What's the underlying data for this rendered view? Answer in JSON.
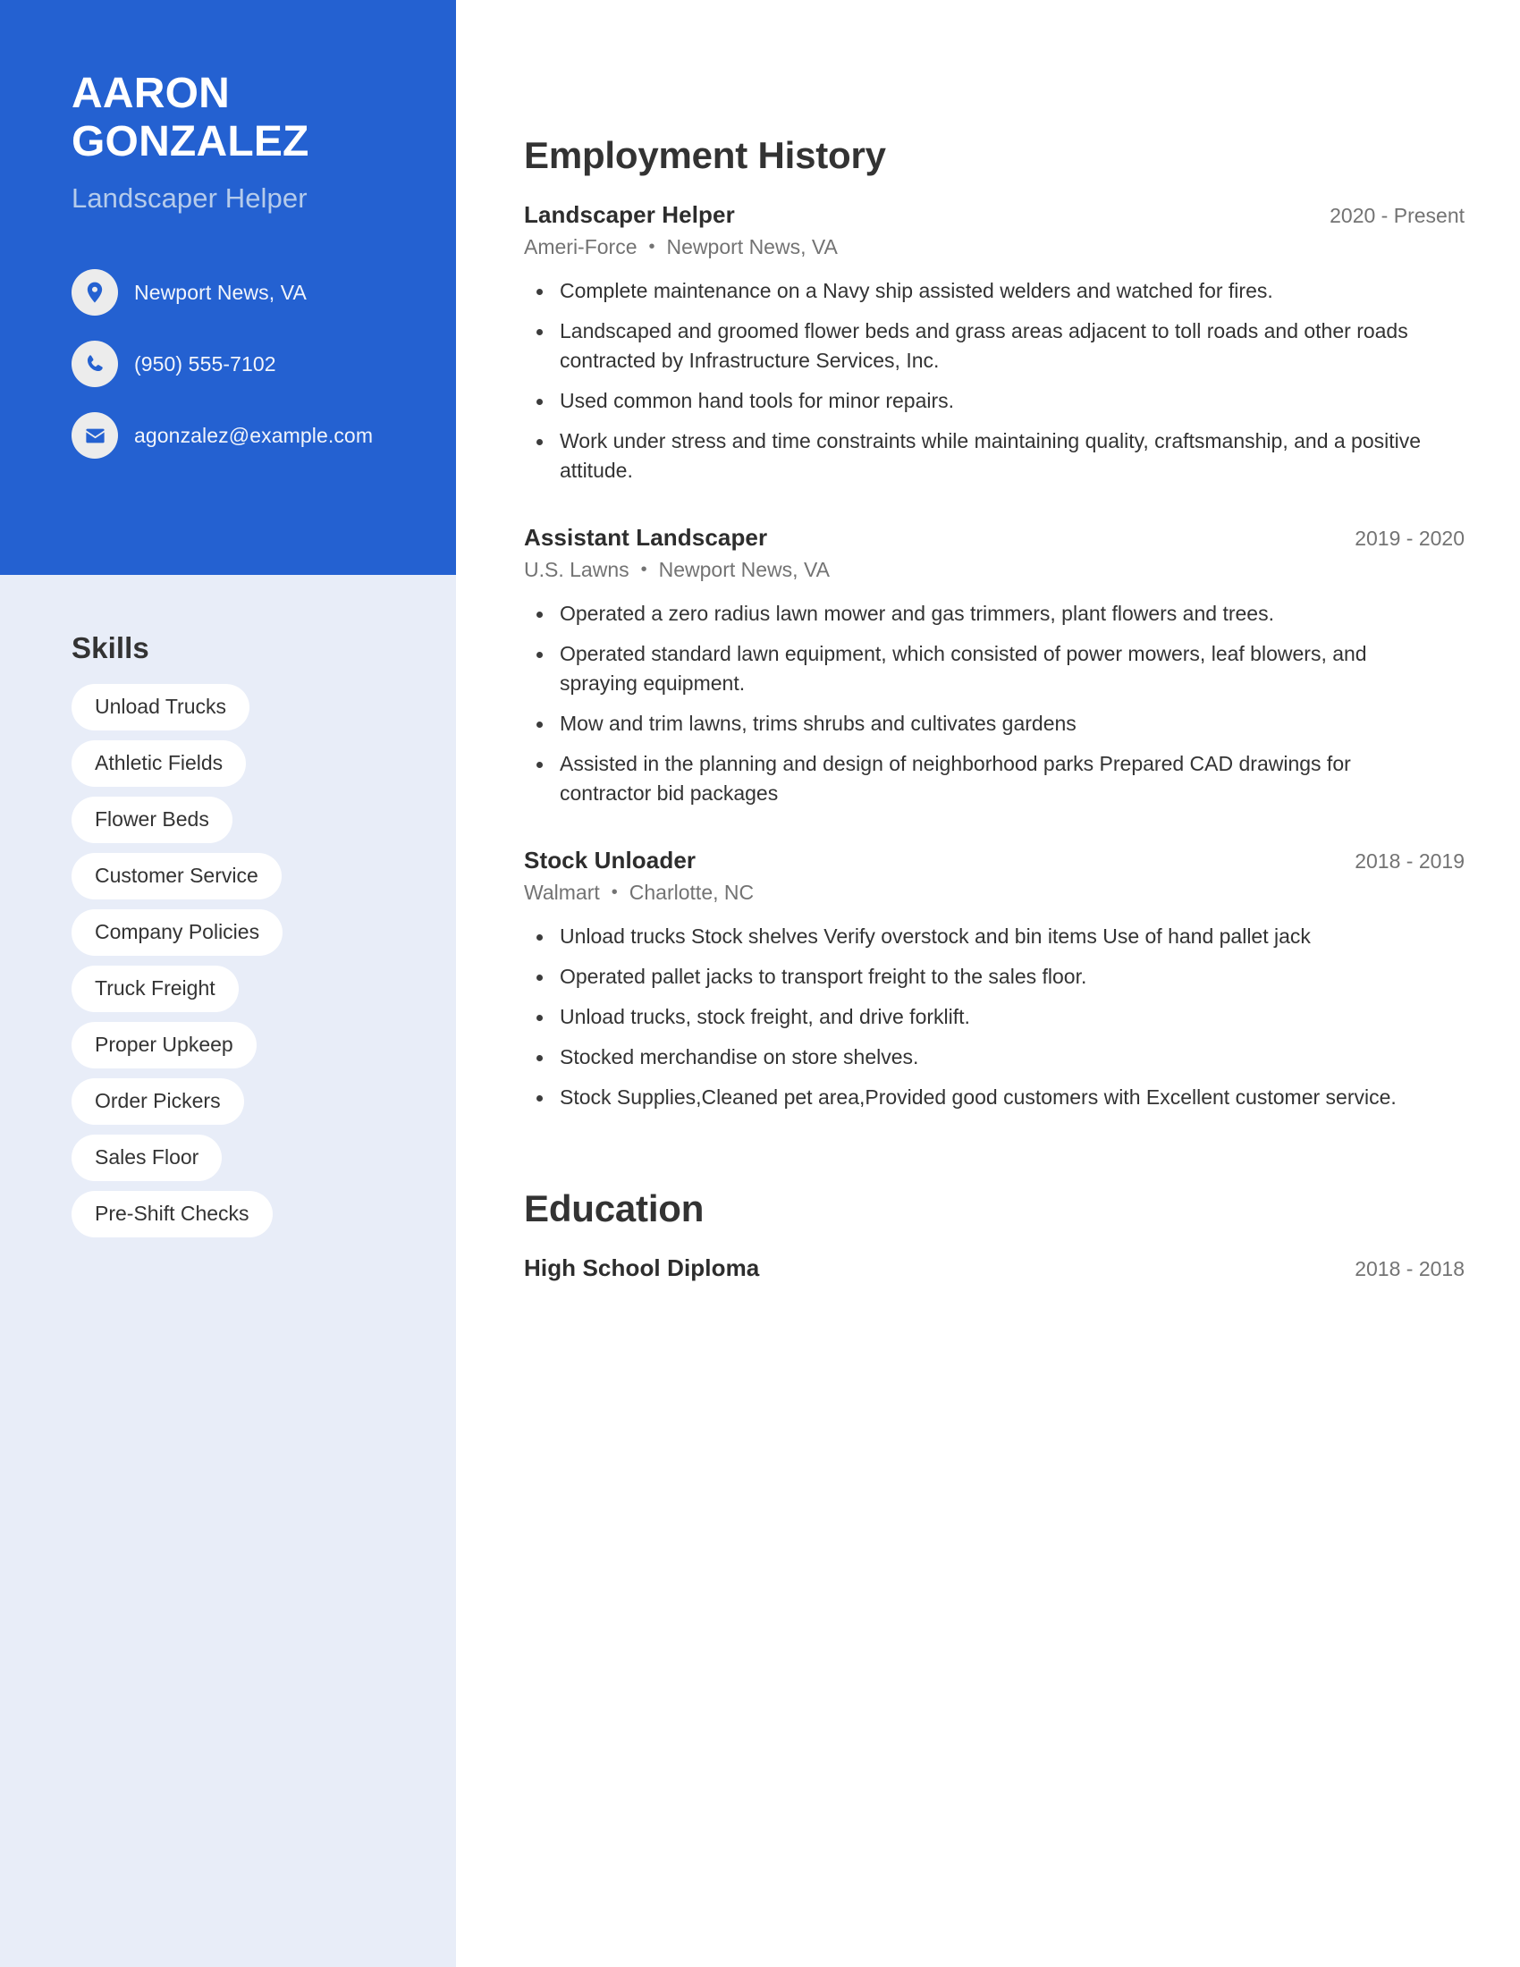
{
  "sidebar": {
    "name": "AARON\nGONZALEZ",
    "name_line1": "AARON",
    "name_line2": "GONZALEZ",
    "job_title": "Landscaper Helper",
    "contacts": [
      {
        "icon": "location-pin-icon",
        "value": "Newport News, VA"
      },
      {
        "icon": "phone-icon",
        "value": "(950) 555-7102"
      },
      {
        "icon": "envelope-icon",
        "value": "agonzalez@example.com"
      }
    ],
    "skills_heading": "Skills",
    "skills": [
      "Unload Trucks",
      "Athletic Fields",
      "Flower Beds",
      "Customer Service",
      "Company Policies",
      "Truck Freight",
      "Proper Upkeep",
      "Order Pickers",
      "Sales Floor",
      "Pre-Shift Checks"
    ]
  },
  "main": {
    "employment_heading": "Employment History",
    "education_heading": "Education",
    "separator": "•",
    "jobs": [
      {
        "role": "Landscaper Helper",
        "dates": "2020 - Present",
        "company": "Ameri-Force",
        "location": "Newport News, VA",
        "bullets": [
          "Complete maintenance on a Navy ship assisted welders and watched for fires.",
          "Landscaped and groomed flower beds and grass areas adjacent to toll roads and other roads contracted by Infrastructure Services, Inc.",
          "Used common hand tools for minor repairs.",
          "Work under stress and time constraints while maintaining quality, craftsmanship, and a positive attitude."
        ]
      },
      {
        "role": "Assistant Landscaper",
        "dates": "2019 - 2020",
        "company": "U.S. Lawns",
        "location": "Newport News, VA",
        "bullets": [
          "Operated a zero radius lawn mower and gas trimmers, plant flowers and trees.",
          "Operated standard lawn equipment, which consisted of power mowers, leaf blowers, and spraying equipment.",
          "Mow and trim lawns, trims shrubs and cultivates gardens",
          "Assisted in the planning and design of neighborhood parks Prepared CAD drawings for contractor bid packages"
        ]
      },
      {
        "role": "Stock Unloader",
        "dates": "2018 - 2019",
        "company": "Walmart",
        "location": "Charlotte, NC",
        "bullets": [
          "Unload trucks Stock shelves Verify overstock and bin items Use of hand pallet jack",
          "Operated pallet jacks to transport freight to the sales floor.",
          "Unload trucks, stock freight, and drive forklift.",
          "Stocked merchandise on store shelves.",
          "Stock Supplies,Cleaned pet area,Provided good customers with Excellent customer service."
        ]
      }
    ],
    "education": [
      {
        "degree": "High School Diploma",
        "dates": "2018 - 2018"
      }
    ]
  },
  "colors": {
    "brand_blue": "#2461d1",
    "sidebar_light": "#e8edf8",
    "subtitle_blue": "#b5cbeb",
    "text_dark": "#333333",
    "text_muted": "#737373",
    "pill_white": "#ffffff"
  }
}
